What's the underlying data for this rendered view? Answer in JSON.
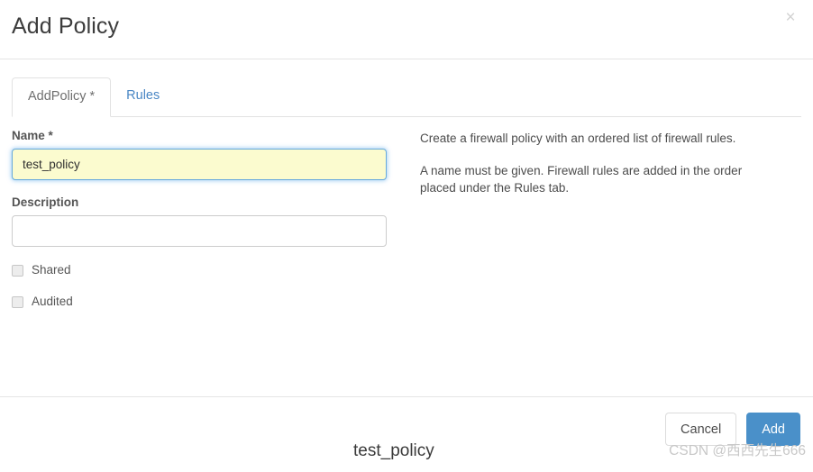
{
  "modal": {
    "title": "Add Policy",
    "close_icon": "close-icon",
    "close_glyph": "×",
    "tabs": [
      {
        "label": "AddPolicy *",
        "active": true
      },
      {
        "label": "Rules",
        "active": false
      }
    ],
    "form": {
      "name_label": "Name",
      "name_required_marker": "*",
      "name_value": "test_policy",
      "name_placeholder": "",
      "description_label": "Description",
      "description_value": "",
      "description_placeholder": "",
      "checkboxes": [
        {
          "label": "Shared",
          "checked": false
        },
        {
          "label": "Audited",
          "checked": false
        }
      ]
    },
    "help": {
      "paragraph1": "Create a firewall policy with an ordered list of firewall rules.",
      "paragraph2": "A name must be given. Firewall rules are added in the order placed under the Rules tab."
    },
    "footer": {
      "cancel_label": "Cancel",
      "add_label": "Add"
    }
  },
  "page_below": {
    "text": "test_policy",
    "watermark": "CSDN @西西先生666"
  },
  "colors": {
    "primary_button": "#4a90c9",
    "tab_link": "#4a87c4",
    "autofill_background": "#fbfbcf",
    "focus_border": "#67a9dd",
    "divider": "#e5e5e5"
  }
}
